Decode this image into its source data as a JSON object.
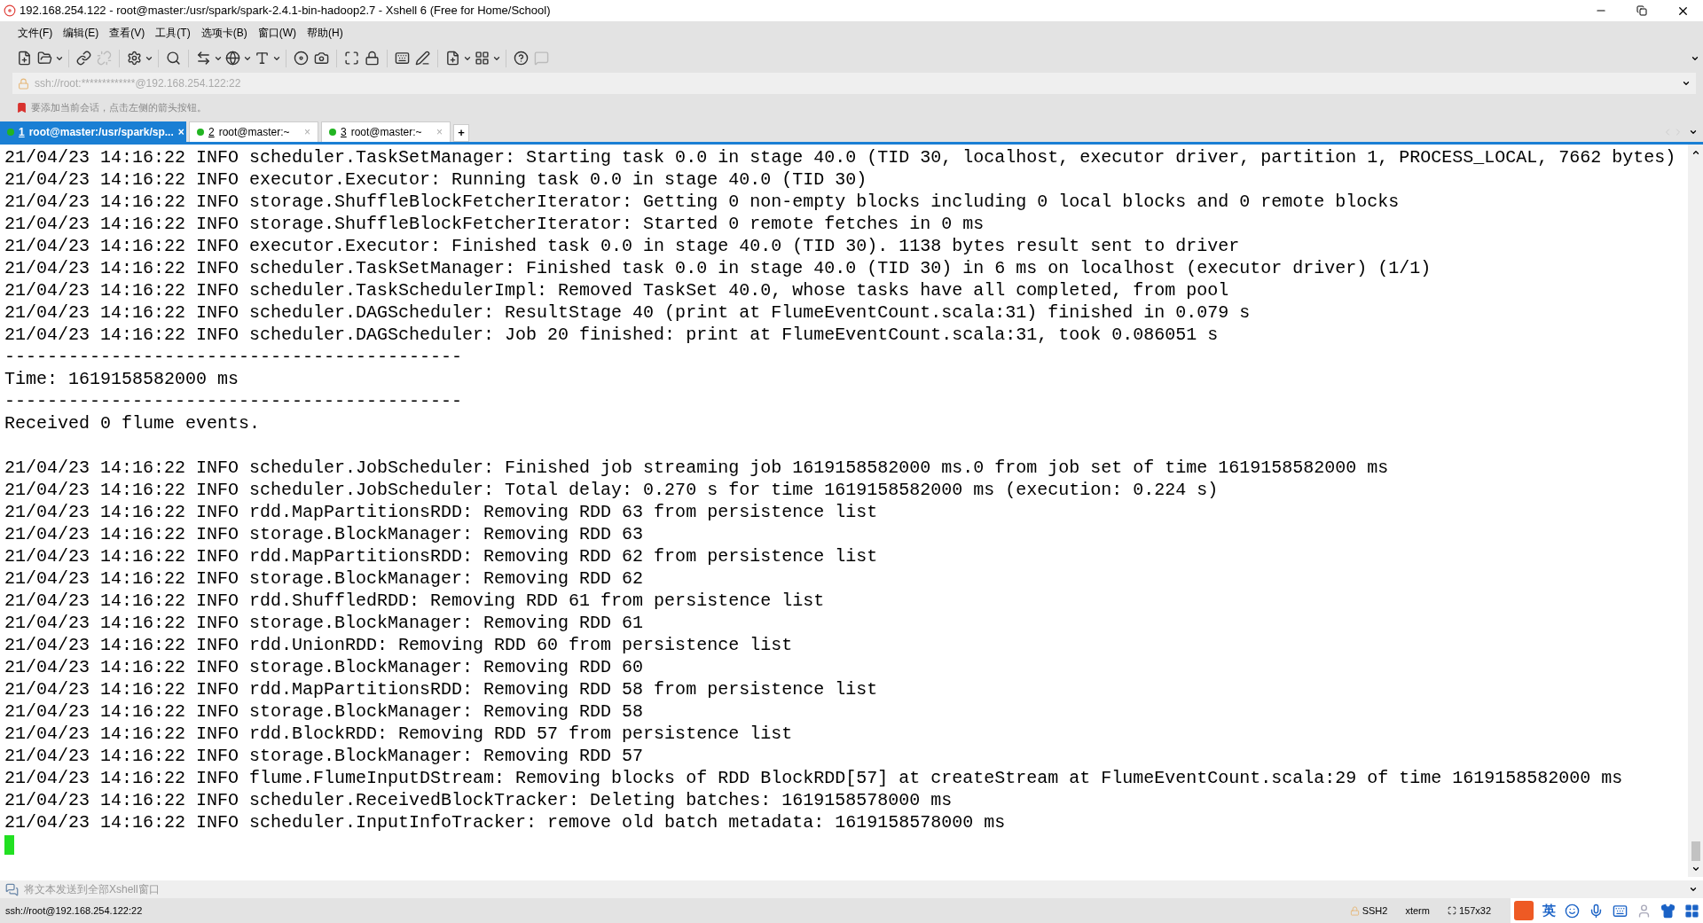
{
  "window": {
    "title": "192.168.254.122 - root@master:/usr/spark/spark-2.4.1-bin-hadoop2.7 - Xshell 6 (Free for Home/School)"
  },
  "menu": [
    "文件(F)",
    "编辑(E)",
    "查看(V)",
    "工具(T)",
    "选项卡(B)",
    "窗口(W)",
    "帮助(H)"
  ],
  "address": {
    "value": "ssh://root:*************@192.168.254.122:22"
  },
  "hint": "要添加当前会话，点击左侧的箭头按钮。",
  "tabs": [
    {
      "number": "1",
      "label": "root@master:/usr/spark/sp...",
      "close": "×",
      "selected": true
    },
    {
      "number": "2",
      "label": "root@master:~",
      "close": "×",
      "selected": false
    },
    {
      "number": "3",
      "label": "root@master:~",
      "close": "×",
      "selected": false
    }
  ],
  "new_tab": "+",
  "terminal": {
    "blocks": [
      [
        "21/04/23 14:16:22 INFO scheduler.TaskSetManager: Starting task 0.0 in stage 40.0 (TID 30, localhost, executor driver, partition 1, PROCESS_LOCAL, 7662 bytes)",
        "21/04/23 14:16:22 INFO executor.Executor: Running task 0.0 in stage 40.0 (TID 30)",
        "21/04/23 14:16:22 INFO storage.ShuffleBlockFetcherIterator: Getting 0 non-empty blocks including 0 local blocks and 0 remote blocks",
        "21/04/23 14:16:22 INFO storage.ShuffleBlockFetcherIterator: Started 0 remote fetches in 0 ms",
        "21/04/23 14:16:22 INFO executor.Executor: Finished task 0.0 in stage 40.0 (TID 30). 1138 bytes result sent to driver",
        "21/04/23 14:16:22 INFO scheduler.TaskSetManager: Finished task 0.0 in stage 40.0 (TID 30) in 6 ms on localhost (executor driver) (1/1)",
        "21/04/23 14:16:22 INFO scheduler.TaskSchedulerImpl: Removed TaskSet 40.0, whose tasks have all completed, from pool",
        "21/04/23 14:16:22 INFO scheduler.DAGScheduler: ResultStage 40 (print at FlumeEventCount.scala:31) finished in 0.079 s",
        "21/04/23 14:16:22 INFO scheduler.DAGScheduler: Job 20 finished: print at FlumeEventCount.scala:31, took 0.086051 s",
        "-------------------------------------------",
        "Time: 1619158582000 ms",
        "-------------------------------------------",
        "Received 0 flume events."
      ],
      [
        "21/04/23 14:16:22 INFO scheduler.JobScheduler: Finished job streaming job 1619158582000 ms.0 from job set of time 1619158582000 ms",
        "21/04/23 14:16:22 INFO scheduler.JobScheduler: Total delay: 0.270 s for time 1619158582000 ms (execution: 0.224 s)",
        "21/04/23 14:16:22 INFO rdd.MapPartitionsRDD: Removing RDD 63 from persistence list",
        "21/04/23 14:16:22 INFO storage.BlockManager: Removing RDD 63",
        "21/04/23 14:16:22 INFO rdd.MapPartitionsRDD: Removing RDD 62 from persistence list",
        "21/04/23 14:16:22 INFO storage.BlockManager: Removing RDD 62",
        "21/04/23 14:16:22 INFO rdd.ShuffledRDD: Removing RDD 61 from persistence list",
        "21/04/23 14:16:22 INFO storage.BlockManager: Removing RDD 61",
        "21/04/23 14:16:22 INFO rdd.UnionRDD: Removing RDD 60 from persistence list",
        "21/04/23 14:16:22 INFO storage.BlockManager: Removing RDD 60",
        "21/04/23 14:16:22 INFO rdd.MapPartitionsRDD: Removing RDD 58 from persistence list",
        "21/04/23 14:16:22 INFO storage.BlockManager: Removing RDD 58",
        "21/04/23 14:16:22 INFO rdd.BlockRDD: Removing RDD 57 from persistence list",
        "21/04/23 14:16:22 INFO storage.BlockManager: Removing RDD 57",
        "21/04/23 14:16:22 INFO flume.FlumeInputDStream: Removing blocks of RDD BlockRDD[57] at createStream at FlumeEventCount.scala:29 of time 1619158582000 ms",
        "21/04/23 14:16:22 INFO scheduler.ReceivedBlockTracker: Deleting batches: 1619158578000 ms",
        "21/04/23 14:16:22 INFO scheduler.InputInfoTracker: remove old batch metadata: 1619158578000 ms"
      ]
    ]
  },
  "compose": {
    "placeholder": "将文本发送到全部Xshell窗口"
  },
  "status_bar": {
    "connection": "ssh://root@192.168.254.122:22",
    "protocol": "SSH2",
    "terminal_type": "xterm",
    "size": "157x32",
    "ime_mode": "英"
  }
}
